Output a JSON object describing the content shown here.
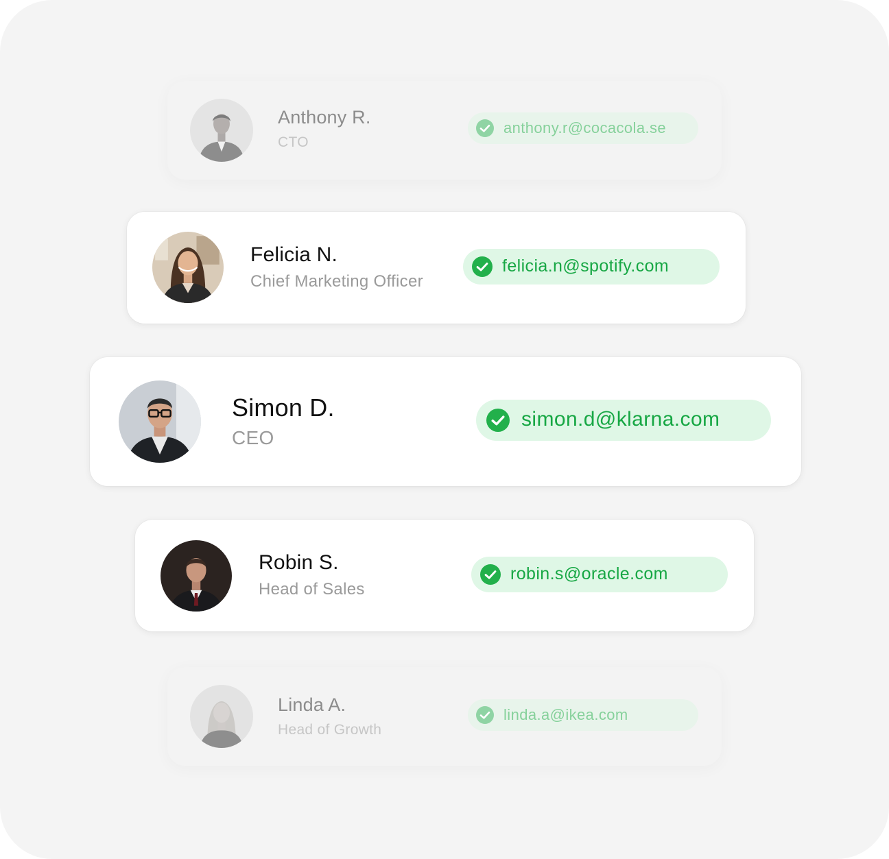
{
  "colors": {
    "panel_bg": "#f4f4f4",
    "card_bg": "#ffffff",
    "email_pill_bg": "#dff7e6",
    "email_text": "#17a744",
    "check_bg": "#22b04b",
    "name_text": "#111111",
    "title_text": "#9a9a9a"
  },
  "contacts": [
    {
      "name": "Anthony R.",
      "title": "CTO",
      "email": "anthony.r@cocacola.se",
      "verified": true,
      "faded": true
    },
    {
      "name": "Felicia N.",
      "title": "Chief Marketing Officer",
      "email": "felicia.n@spotify.com",
      "verified": true,
      "faded": false
    },
    {
      "name": "Simon D.",
      "title": "CEO",
      "email": "simon.d@klarna.com",
      "verified": true,
      "faded": false
    },
    {
      "name": "Robin S.",
      "title": "Head of Sales",
      "email": "robin.s@oracle.com",
      "verified": true,
      "faded": false
    },
    {
      "name": "Linda A.",
      "title": "Head of Growth",
      "email": "linda.a@ikea.com",
      "verified": true,
      "faded": true
    }
  ],
  "icons": {
    "verified": "check-circle-icon",
    "avatar": "person-photo"
  }
}
